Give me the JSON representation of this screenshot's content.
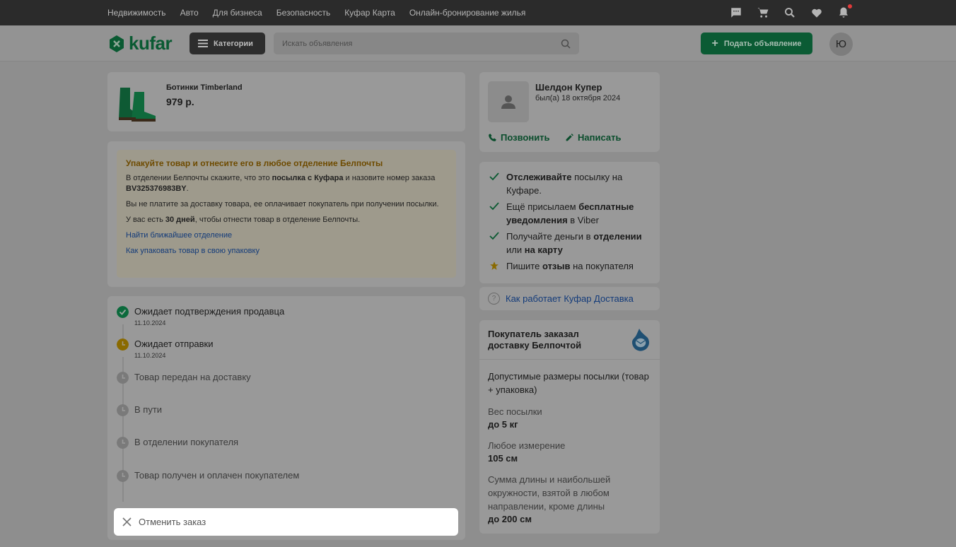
{
  "topnav": {
    "links": [
      "Недвижимость",
      "Авто",
      "Для бизнеса",
      "Безопасность",
      "Куфар Карта",
      "Онлайн-бронирование жилья"
    ]
  },
  "header": {
    "logo": "kufar",
    "categories_label": "Категории",
    "search_placeholder": "Искать объявления",
    "post_label": "Подать объявление",
    "avatar_letter": "Ю"
  },
  "product": {
    "name": "Ботинки Timberland",
    "price": "979 р."
  },
  "instructions": {
    "title": "Упакуйте товар и отнесите его в любое отделение Белпочты",
    "p1_a": "В отделении Белпочты скажите, что это ",
    "p1_b": "посылка с Куфара",
    "p1_c": " и назовите номер заказа ",
    "p1_d": "BV325376983BY",
    "p1_e": ".",
    "p2": "Вы не платите за доставку товара, ее оплачивает покупатель при получении посылки.",
    "p3_a": "У вас есть ",
    "p3_b": "30 дней",
    "p3_c": ", чтобы отнести товар в отделение Белпочты.",
    "link1": "Найти ближайшее отделение",
    "link2": "Как упаковать товар в свою упаковку"
  },
  "timeline": [
    {
      "label": "Ожидает подтверждения продавца",
      "date": "11.10.2024",
      "state": "done"
    },
    {
      "label": "Ожидает отправки",
      "date": "11.10.2024",
      "state": "current"
    },
    {
      "label": "Товар передан на доставку",
      "date": "",
      "state": "pending"
    },
    {
      "label": "В пути",
      "date": "",
      "state": "pending"
    },
    {
      "label": "В отделении покупателя",
      "date": "",
      "state": "pending"
    },
    {
      "label": "Товар получен и оплачен покупателем",
      "date": "",
      "state": "pending"
    }
  ],
  "cancel_label": "Отменить заказ",
  "seller": {
    "name": "Шелдон Купер",
    "seen": "был(а) 18 октября 2024",
    "call": "Позвонить",
    "write": "Написать"
  },
  "benefits": {
    "b1_a": "Отслеживайте",
    "b1_b": " посылку на Куфаре.",
    "b2_a": "Ещё присылаем ",
    "b2_b": "бесплатные уведомления",
    "b2_c": " в Viber",
    "b3_a": "Получайте деньги в ",
    "b3_b": "отделении",
    "b3_c": " или ",
    "b3_d": "на карту",
    "b4_a": "Пишите ",
    "b4_b": "отзыв",
    "b4_c": " на покупателя"
  },
  "how_label": "Как работает Куфар Доставка",
  "delivery": {
    "title": "Покупатель заказал доставку Белпочтой",
    "sizes": "Допустимые размеры посылки (товар + упаковка)",
    "weight_k": "Вес посылки",
    "weight_v": "до 5 кг",
    "dim_k": "Любое измерение",
    "dim_v": "105 см",
    "sum_k": "Сумма длины и наибольшей окружности, взятой в любом направлении, кроме длины",
    "sum_v": "до 200 см"
  },
  "colors": {
    "brand": "#0a5a32",
    "done": "#0b6a3c",
    "current": "#8a6a00",
    "pending": "#7a7a7a"
  }
}
